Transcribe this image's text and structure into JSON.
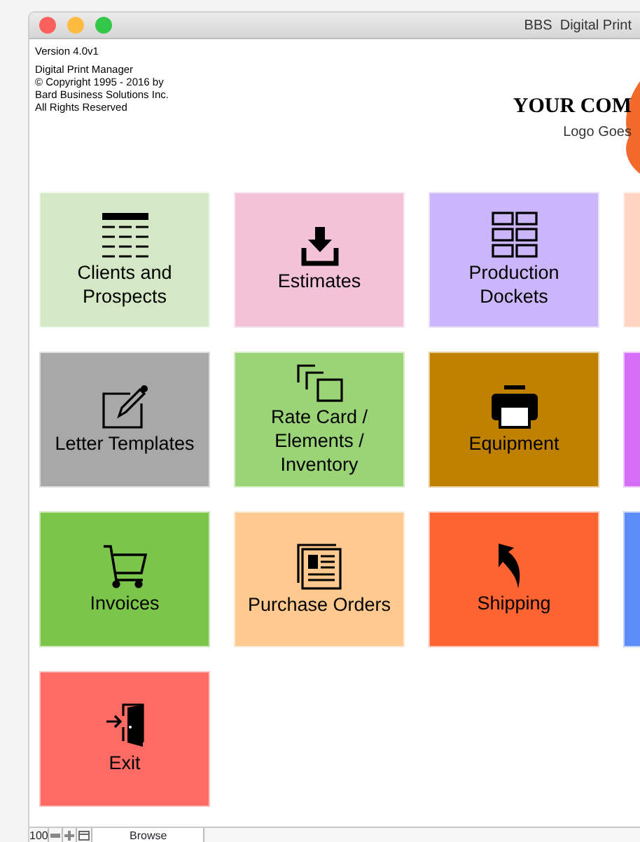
{
  "window": {
    "title": "BBS  Digital Print"
  },
  "header": {
    "version": "Version 4.0v1",
    "lines": [
      "Digital Print Manager",
      "© Copyright 1995 -  2016 by",
      "Bard Business Solutions Inc.",
      "All Rights Reserved"
    ]
  },
  "logo": {
    "name": "YOUR COM",
    "tagline": "Logo Goes"
  },
  "tiles": [
    {
      "label": "Clients and Prospects",
      "color": "#d5e8c5"
    },
    {
      "label": "Estimates",
      "color": "#f4c2d6"
    },
    {
      "label": "Production Dockets",
      "color": "#cbb6fb"
    },
    {
      "color": "#fed5c2"
    },
    {
      "label": "Letter Templates",
      "color": "#a8a8a8"
    },
    {
      "label": "Rate Card / Elements / Inventory",
      "color": "#9ad476"
    },
    {
      "label": "Equipment",
      "color": "#c08100"
    },
    {
      "color": "#d56ef6"
    },
    {
      "label": "Invoices",
      "color": "#7bc64a"
    },
    {
      "label": "Purchase Orders",
      "color": "#fec98e"
    },
    {
      "label": "Shipping",
      "color": "#fe6432"
    },
    {
      "color": "#5b8cf8"
    },
    {
      "label": "Exit",
      "color": "#fe6a64"
    }
  ],
  "status_bar": {
    "zoom": "100",
    "mode": "Browse"
  }
}
